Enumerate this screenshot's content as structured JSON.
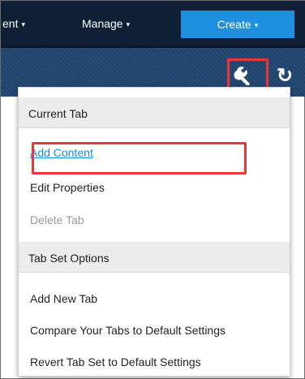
{
  "topnav": {
    "cut_item_label": "ent",
    "manage_label": "Manage",
    "create_label": "Create",
    "caret": "▾"
  },
  "toolbar": {
    "settings_icon": "wrench-icon",
    "refresh_icon": "refresh-icon",
    "refresh_glyph": "↻"
  },
  "menu": {
    "sections": [
      {
        "header": "Current Tab",
        "items": [
          {
            "label": "Add Content",
            "state": "link"
          },
          {
            "label": "Edit Properties",
            "state": "normal"
          },
          {
            "label": "Delete Tab",
            "state": "disabled"
          }
        ]
      },
      {
        "header": "Tab Set Options",
        "items": [
          {
            "label": "Add New Tab",
            "state": "normal"
          },
          {
            "label": "Compare Your Tabs to Default Settings",
            "state": "normal"
          },
          {
            "label": "Revert Tab Set to Default Settings",
            "state": "normal"
          }
        ]
      }
    ]
  },
  "colors": {
    "nav_bg": "#0f1f36",
    "create_button": "#1e90e0",
    "toolbar_bg": "#22436a",
    "link": "#1a8ae0",
    "disabled": "#9a9a9a",
    "highlight_box": "#e8363b",
    "section_header_bg": "#ececec"
  }
}
